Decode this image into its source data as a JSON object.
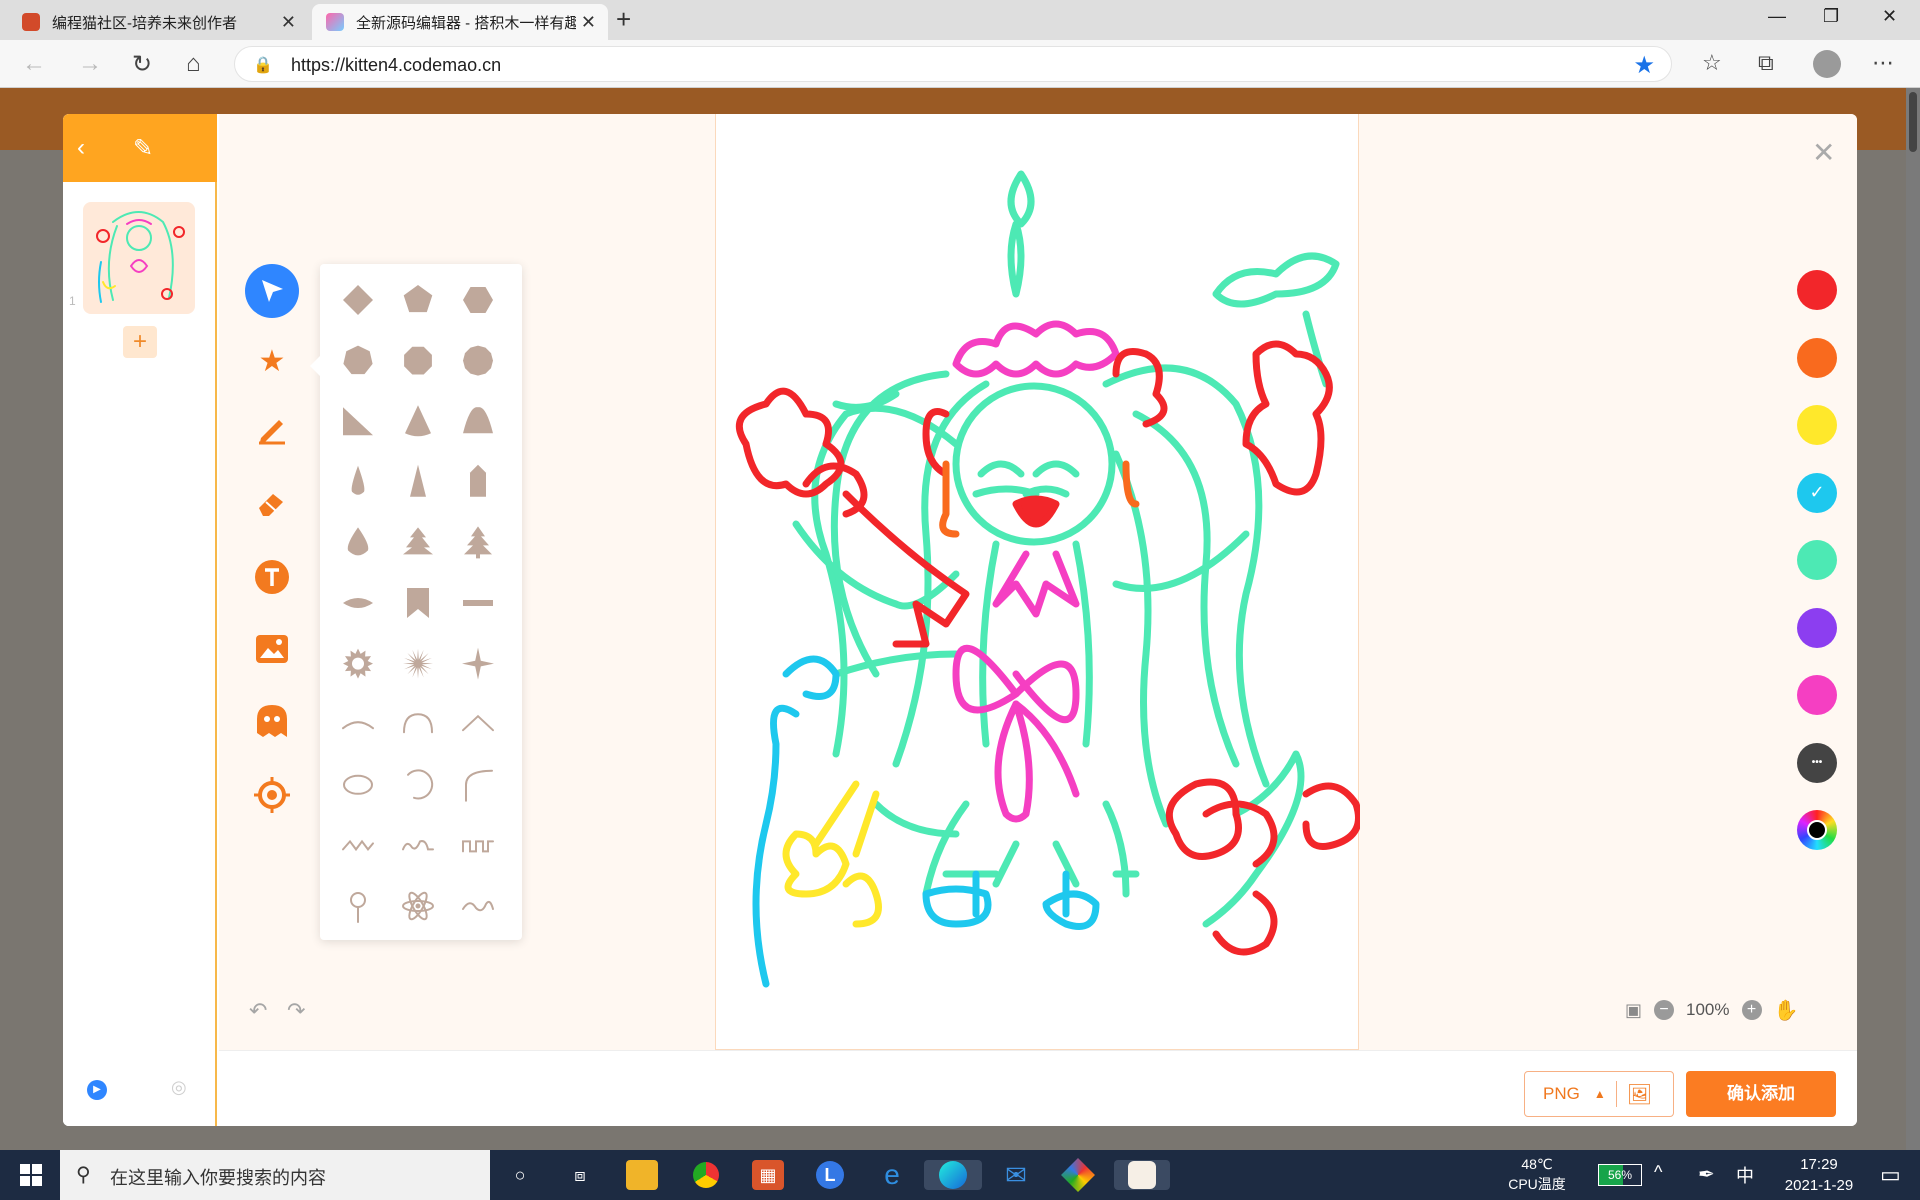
{
  "browser": {
    "tabs": [
      {
        "title": "编程猫社区-培养未来创作者",
        "active": false
      },
      {
        "title": "全新源码编辑器 - 搭积木一样有趣",
        "active": true
      }
    ],
    "url": "https://kitten4.codemao.cn",
    "url_icon": "lock-icon",
    "favorite_icon": "star-filled-icon"
  },
  "editor": {
    "frame_index": "1",
    "add_frame_label": "+",
    "tools": [
      {
        "name": "select",
        "icon": "cursor-icon",
        "selected": true
      },
      {
        "name": "shape",
        "icon": "star-icon",
        "selected": false
      },
      {
        "name": "pencil",
        "icon": "pencil-icon",
        "selected": false
      },
      {
        "name": "eraser",
        "icon": "eraser-icon",
        "selected": false
      },
      {
        "name": "text",
        "icon": "text-icon",
        "selected": false
      },
      {
        "name": "image",
        "icon": "image-icon",
        "selected": false
      },
      {
        "name": "character",
        "icon": "ghost-icon",
        "selected": false
      },
      {
        "name": "center",
        "icon": "target-icon",
        "selected": false
      }
    ],
    "shapes": [
      "diamond",
      "pentagon",
      "hexagon",
      "heptagon",
      "octagon",
      "circle-many",
      "right-triangle",
      "cone",
      "half-circle",
      "drop-narrow",
      "spike",
      "pencil-tip",
      "water-drop",
      "tree",
      "pine-tree",
      "ellipse-leaf",
      "bookmark",
      "bar",
      "sun-burst",
      "star-burst",
      "four-point-star",
      "arc-flat",
      "arc-round",
      "chevron-line",
      "ellipse",
      "circle-arc",
      "corner-curve",
      "zigzag-wave",
      "bump-wave",
      "square-wave",
      "pin",
      "atom",
      "sine-wave"
    ],
    "colors": [
      {
        "hex": "#f2262a",
        "selected": false
      },
      {
        "hex": "#f96a1e",
        "selected": false
      },
      {
        "hex": "#ffe82b",
        "selected": false
      },
      {
        "hex": "#1ec8ee",
        "selected": true
      },
      {
        "hex": "#4de9b4",
        "selected": false
      },
      {
        "hex": "#8c3ef0",
        "selected": false
      },
      {
        "hex": "#f53fc2",
        "selected": false
      },
      {
        "hex": "#444444",
        "selected": false,
        "icon": "more-icon"
      },
      {
        "hex": "#000000",
        "selected": false,
        "icon": "color-wheel-icon"
      }
    ],
    "zoom": "100%",
    "format": "PNG",
    "confirm_label": "确认添加"
  },
  "taskbar": {
    "search_placeholder": "在这里输入你要搜索的内容",
    "cpu_temp": "48℃",
    "cpu_label": "CPU温度",
    "battery": "56%",
    "battery_level": 56,
    "ime": "中",
    "time": "17:29",
    "date": "2021-1-29"
  }
}
